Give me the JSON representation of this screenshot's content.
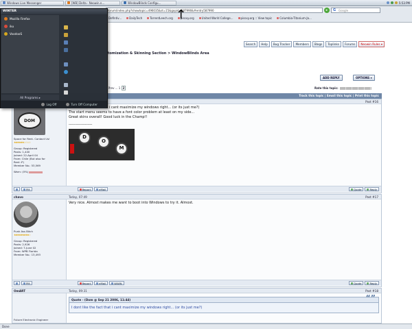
{
  "taskbar": {
    "items": [
      "Windows Live Messenger",
      "[WB] Delta - Neowin.n...",
      "WindowBlinds Configu..."
    ],
    "clock": "5:53 PM"
  },
  "browser": {
    "address": "forum/index.php?showtopic=496035&st=15&gopid=587990&#entry587990",
    "search_label": "Google",
    "bookmarks": [
      "Defintiv...",
      "DailyTech",
      "TorrentLeech.org",
      "pissxy.org",
      "United World College...",
      "pissxy.org :: View topic",
      "Columbia-Titanium-Ja..."
    ]
  },
  "nav": {
    "buttons": [
      "Search",
      "Help",
      "Bug Tracker",
      "Members",
      "Blogs",
      "Toplinks",
      "Forums",
      "Neowin Rules ▾"
    ]
  },
  "breadcrumb": "stomization & Skinning Section > WindowBlinds Area",
  "actions": {
    "add_reply": "ADD REPLY",
    "options": "OPTIONS ▾"
  },
  "pager": {
    "prev": "« Prev ... 1",
    "current": "2"
  },
  "rate_label": "Rate this topic:",
  "topic_bar": "Track this topic | Email this topic | Print this topic",
  "posts": [
    {
      "author": "",
      "time": "",
      "no": "Post #16",
      "text": [
        "I dont like the fact that i cant maximize my windows right... (or its just me?)",
        "The start menu seems to have a font color problem at least on my side...",
        "Great skins overall! Good luck in the Champ!!",
        "-------------------"
      ],
      "sig": [
        "D",
        "O",
        "M"
      ],
      "side": {
        "title": "Space for Rent. Contact Us!",
        "group": "Group: Registered",
        "posts": "Posts: 1,440",
        "joined": "Joined: 22-April 04",
        "from": "From: Chile (But also for",
        "from2": "Rent :P)",
        "member": "Member No.: 53,569",
        "warn": "Warn: (0%)"
      },
      "avatar_text": "DOM",
      "footer": [
        "PM",
        "Report",
        "eMail"
      ]
    },
    {
      "author": "chavo",
      "time": "Today, 07:49",
      "no": "Post #17",
      "text": [
        "Very nice. Almost makes me want to boot into Windows to try it. Almost."
      ],
      "side": {
        "title": "Punk Ass Bitch",
        "group": "Group: Registered",
        "posts": "Posts: 2,926",
        "joined": "Joined: 7-June 02",
        "from": "From: WPB Florida",
        "member": "Member No.: 13,493"
      },
      "footer": [
        "PM",
        "Report",
        "eMail",
        "WWW"
      ]
    },
    {
      "author": "OmART",
      "time": "Today, 09:31",
      "no": "Post #18",
      "quote_head": "Quote - (Dom @ Sep 21 2006, 11:44)",
      "quote_text": "I dont like the fact that i cant maximize my windows right... (or its just me?)",
      "side": {
        "title": "Future Electronic Engineer"
      }
    }
  ],
  "post_footer_right": {
    "quote": "Quote",
    "reply": "Reply"
  },
  "start_menu": {
    "user": "WINTER",
    "left_items": [
      "Mozilla Firefox",
      "iku",
      "VoodooS"
    ],
    "all_programs": "All Programs ▸",
    "log_off": "Log Off",
    "turn_off": "Turn Off Computer"
  },
  "status": "Done",
  "colors": {
    "topic_bar": "#6f87a7",
    "start_menu_bg": "#2a3038",
    "link_blue": "#2a48a0"
  }
}
